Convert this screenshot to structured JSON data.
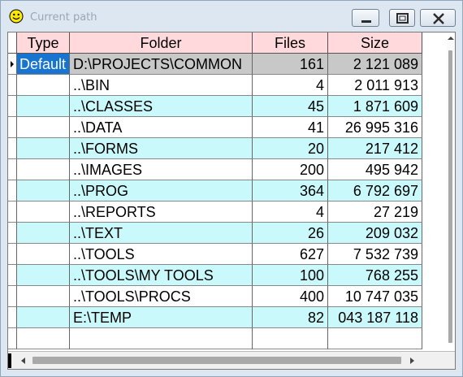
{
  "window": {
    "title": "Current path",
    "buttons": {
      "minimize": "minimize-icon",
      "maximize": "maximize-icon",
      "close": "close-icon"
    }
  },
  "table": {
    "columns": [
      "Type",
      "Folder",
      "Files",
      "Size"
    ],
    "rows": [
      {
        "type": "Default",
        "folder": "D:\\PROJECTS\\COMMON",
        "files": "161",
        "size": "2 121 089"
      },
      {
        "type": "",
        "folder": "..\\BIN",
        "files": "4",
        "size": "2 011 913"
      },
      {
        "type": "",
        "folder": "..\\CLASSES",
        "files": "45",
        "size": "1 871 609"
      },
      {
        "type": "",
        "folder": "..\\DATA",
        "files": "41",
        "size": "26 995 316"
      },
      {
        "type": "",
        "folder": "..\\FORMS",
        "files": "20",
        "size": "217 412"
      },
      {
        "type": "",
        "folder": "..\\IMAGES",
        "files": "200",
        "size": "495 942"
      },
      {
        "type": "",
        "folder": "..\\PROG",
        "files": "364",
        "size": "6 792 697"
      },
      {
        "type": "",
        "folder": "..\\REPORTS",
        "files": "4",
        "size": "27 219"
      },
      {
        "type": "",
        "folder": "..\\TEXT",
        "files": "26",
        "size": "209 032"
      },
      {
        "type": "",
        "folder": "..\\TOOLS",
        "files": "627",
        "size": "7 532 739"
      },
      {
        "type": "",
        "folder": "..\\TOOLS\\MY TOOLS",
        "files": "100",
        "size": "768 255"
      },
      {
        "type": "",
        "folder": "..\\TOOLS\\PROCS",
        "files": "400",
        "size": "10 747 035"
      },
      {
        "type": "",
        "folder": "E:\\TEMP",
        "files": "82",
        "size": "043 187 118"
      }
    ]
  },
  "colors": {
    "header_bg": "#ffd9dc",
    "row_alt": "#c9f9fb",
    "selected_type_bg": "#1874d1",
    "active_row_bg": "#c8c8c8"
  }
}
